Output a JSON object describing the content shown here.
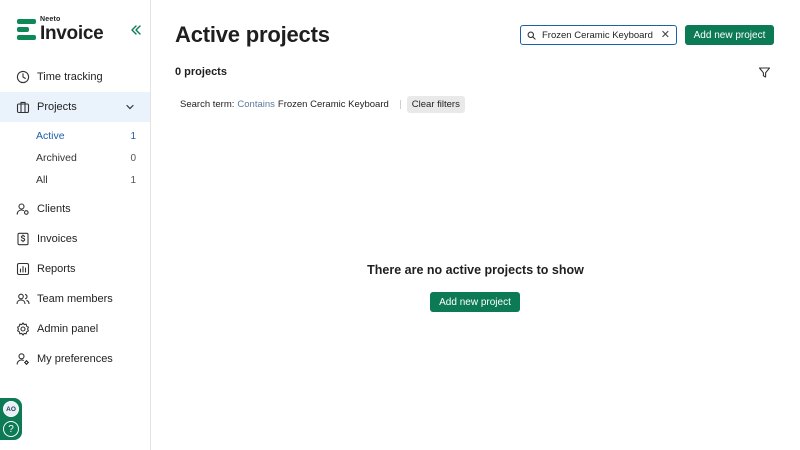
{
  "app": {
    "brand_small": "Neeto",
    "brand_name": "Invoice",
    "accent": "#0b7a55"
  },
  "sidebar": {
    "items": [
      {
        "label": "Time tracking",
        "icon": "clock-icon"
      },
      {
        "label": "Projects",
        "icon": "briefcase-icon"
      },
      {
        "label": "Clients",
        "icon": "user-settings-icon"
      },
      {
        "label": "Invoices",
        "icon": "dollar-document-icon"
      },
      {
        "label": "Reports",
        "icon": "bar-chart-icon"
      },
      {
        "label": "Team members",
        "icon": "users-icon"
      },
      {
        "label": "Admin panel",
        "icon": "gear-icon"
      },
      {
        "label": "My preferences",
        "icon": "user-gear-icon"
      }
    ],
    "project_subitems": [
      {
        "label": "Active",
        "count": "1"
      },
      {
        "label": "Archived",
        "count": "0"
      },
      {
        "label": "All",
        "count": "1"
      }
    ],
    "user_initials": "AO",
    "help_glyph": "?"
  },
  "header": {
    "title": "Active projects",
    "search_value": "Frozen Ceramic Keyboard",
    "add_button": "Add new project"
  },
  "list": {
    "count_text": "0 projects"
  },
  "filters": {
    "term_label": "Search term:",
    "operator": "Contains",
    "term_value": "Frozen Ceramic Keyboard",
    "clear_label": "Clear filters"
  },
  "empty_state": {
    "message": "There are no active projects to show",
    "button": "Add new project"
  }
}
